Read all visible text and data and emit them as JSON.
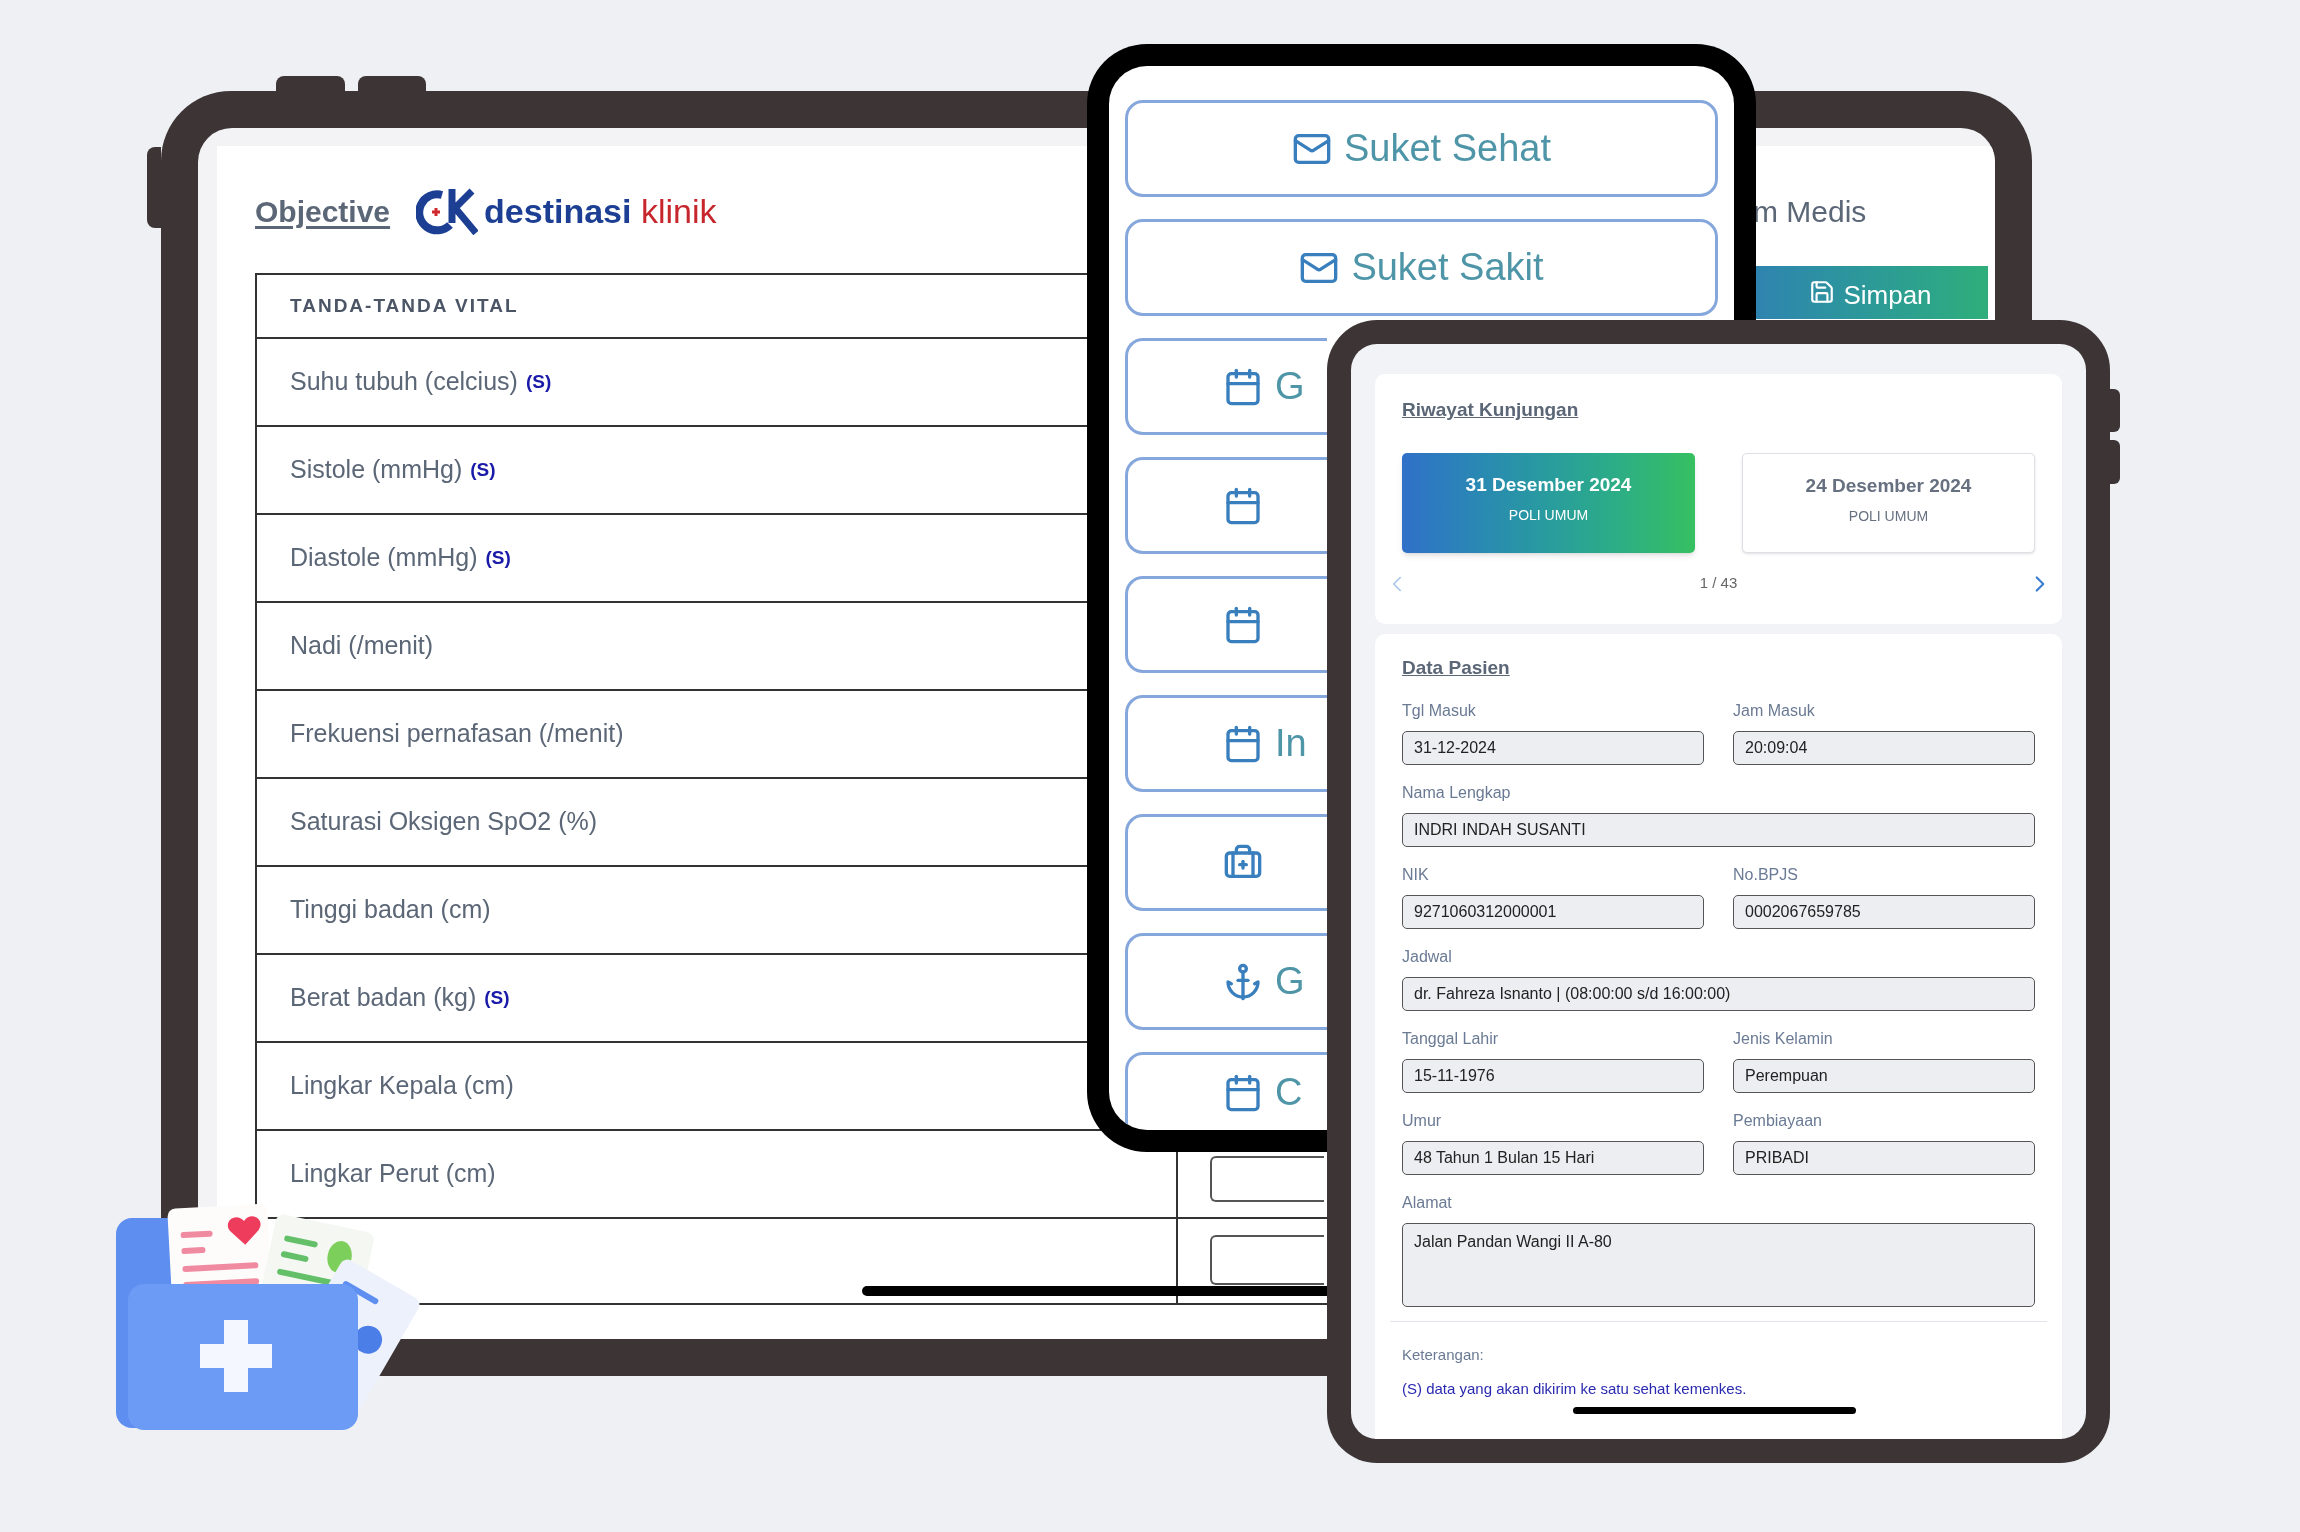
{
  "left_tablet": {
    "title": "Objective",
    "logo": {
      "part_1": "destinasi",
      "part_2": "klinik"
    },
    "vitals_table": {
      "header": "TANDA-TANDA VITAL",
      "rows": [
        {
          "label": "Suhu tubuh (celcius)",
          "flag": "(S)"
        },
        {
          "label": "Sistole (mmHg)",
          "flag": "(S)"
        },
        {
          "label": "Diastole (mmHg)",
          "flag": "(S)"
        },
        {
          "label": "Nadi (/menit)"
        },
        {
          "label": "Frekuensi pernafasan (/menit)"
        },
        {
          "label": "Saturasi Oksigen SpO2 (%)"
        },
        {
          "label": "Tinggi badan (cm)"
        },
        {
          "label": "Berat badan (kg)",
          "flag": "(S)"
        },
        {
          "label": "Lingkar Kepala (cm)"
        },
        {
          "label": "Lingkar Perut (cm)"
        }
      ]
    },
    "panel_title": "m Medis",
    "save_button": "Simpan"
  },
  "phone": {
    "buttons": [
      {
        "kind": "mail",
        "label": "Suket Sehat"
      },
      {
        "kind": "mail",
        "label": "Suket Sakit"
      },
      {
        "kind": "calendar",
        "label": "G"
      },
      {
        "kind": "calendar"
      },
      {
        "kind": "calendar"
      },
      {
        "kind": "calendar",
        "label": "In"
      },
      {
        "kind": "medkit"
      },
      {
        "kind": "anchor",
        "label": "G"
      },
      {
        "kind": "calendar",
        "label": "C"
      }
    ]
  },
  "right_tablet": {
    "visits": {
      "title": "Riwayat Kunjungan",
      "items": [
        {
          "date": "31 Desember 2024",
          "clinic": "POLI UMUM",
          "selected": true
        },
        {
          "date": "24 Desember 2024",
          "clinic": "POLI UMUM",
          "selected": false
        }
      ],
      "pager": "1 / 43"
    },
    "patient": {
      "title": "Data Pasien",
      "rows": [
        [
          {
            "label": "Tgl Masuk",
            "value": "31-12-2024",
            "kind": "input"
          },
          {
            "label": "Jam Masuk",
            "value": "20:09:04",
            "kind": "input"
          }
        ],
        [
          {
            "label": "Nama Lengkap",
            "value": "INDRI INDAH SUSANTI",
            "kind": "input"
          }
        ],
        [
          {
            "label": "NIK",
            "value": "9271060312000001",
            "kind": "input"
          },
          {
            "label": "No.BPJS",
            "value": "0002067659785",
            "kind": "input"
          }
        ],
        [
          {
            "label": "Jadwal",
            "value": "dr. Fahreza Isnanto | (08:00:00 s/d 16:00:00)",
            "kind": "input"
          }
        ],
        [
          {
            "label": "Tanggal Lahir",
            "value": "15-11-1976",
            "kind": "input"
          },
          {
            "label": "Jenis Kelamin",
            "value": "Perempuan",
            "kind": "input"
          }
        ],
        [
          {
            "label": "Umur",
            "value": "48 Tahun 1 Bulan 15 Hari",
            "kind": "input"
          },
          {
            "label": "Pembiayaan",
            "value": "PRIBADI",
            "kind": "input"
          }
        ],
        [
          {
            "label": "Alamat",
            "value": "Jalan Pandan Wangi II A-80",
            "kind": "textarea"
          }
        ]
      ],
      "notes_title": "Keterangan:",
      "note": "(S) data yang akan dikirim ke satu sehat kemenkes."
    }
  }
}
